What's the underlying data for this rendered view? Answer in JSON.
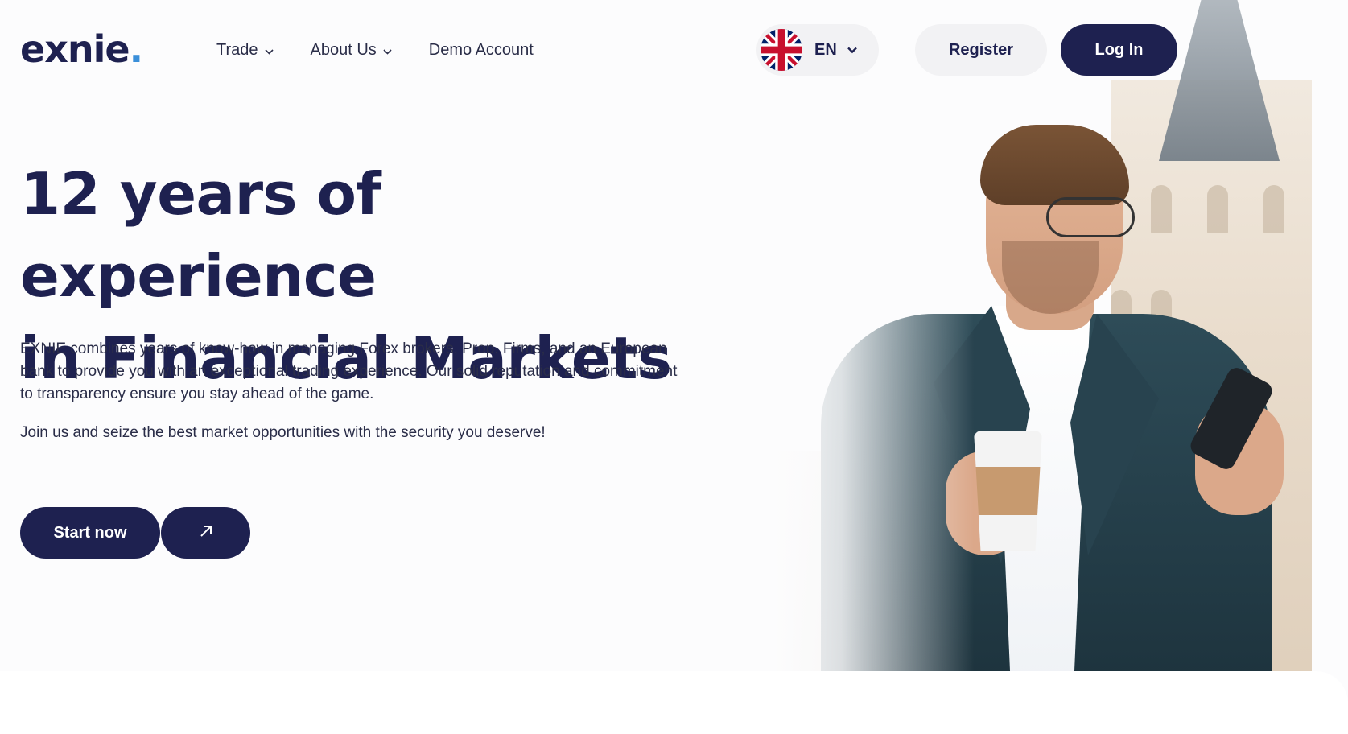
{
  "brand": {
    "name": "exnie",
    "dot": ".",
    "accent_color": "#3a8fd9",
    "primary_color": "#1e2150"
  },
  "nav": {
    "items": [
      {
        "label": "Trade",
        "has_dropdown": true
      },
      {
        "label": "About Us",
        "has_dropdown": true
      },
      {
        "label": "Demo Account",
        "has_dropdown": false
      }
    ]
  },
  "language": {
    "code": "EN",
    "flag": "uk-flag-icon"
  },
  "auth": {
    "register_label": "Register",
    "login_label": "Log In"
  },
  "hero": {
    "headline_line1": "12 years of experience",
    "headline_line2": "in Financial Markets",
    "paragraph1": "EXNIE combines years of know-how in managing Forex brokers, Prop. Firms, and an European bank to provide you with an exceptional trading experience. Our solid reputation and commitment to transparency ensure you stay ahead of the game.",
    "paragraph2": "Join us and seize the best market opportunities with the security you deserve!",
    "cta_label": "Start now",
    "cta_icon": "arrow-up-right-icon"
  }
}
